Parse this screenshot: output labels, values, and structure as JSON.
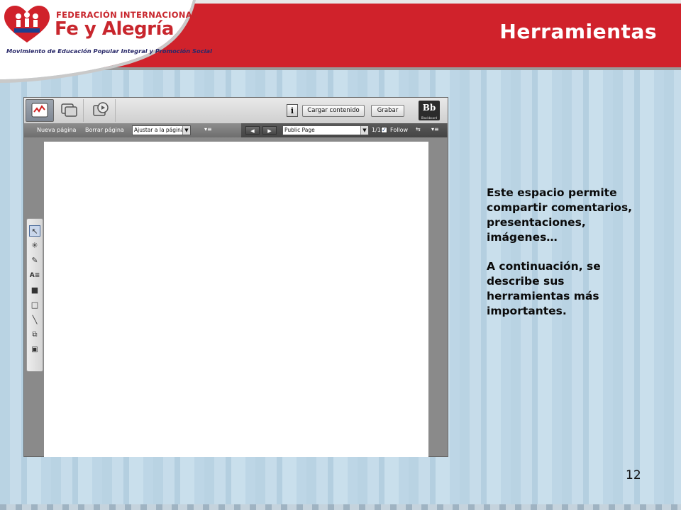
{
  "slide": {
    "title": "Herramientas",
    "page_number": "12",
    "paragraphs": [
      "Este espacio permite compartir comentarios, presentaciones, imágenes…",
      "A continuación, se describe sus herramientas más importantes."
    ]
  },
  "logo": {
    "line1": "FEDERACIÓN INTERNACIONAL",
    "line2": "Fe y Alegría",
    "line3": "Movimiento de Educación Popular Integral y Promoción Social",
    "badge": "FE Y ALEGRIA"
  },
  "app": {
    "toolbar": {
      "load_content_label": "Cargar contenido",
      "record_label": "Grabar",
      "info_icon": "i",
      "brand_logo": "Bb",
      "brand_sub": "Blackboard"
    },
    "row2": {
      "new_page_label": "Nueva página",
      "delete_page_label": "Borrar página",
      "zoom_select_value": "Ajustar a la página",
      "page_select_value": "Public Page",
      "page_counter": "1/1",
      "follow_label": "Follow"
    },
    "icons": {
      "tab_whiteboard": "whiteboard-icon",
      "tab_apps": "application-share-icon",
      "tab_web": "web-tour-icon",
      "tools": [
        "select-arrow-icon",
        "laser-pointer-icon",
        "eraser-icon",
        "text-icon",
        "filled-rectangle-icon",
        "rectangle-icon",
        "line-icon",
        "screenshot-icon",
        "image-icon"
      ]
    }
  },
  "colors": {
    "header_red": "#d0222b",
    "background_blue": "#c0d8e8"
  }
}
